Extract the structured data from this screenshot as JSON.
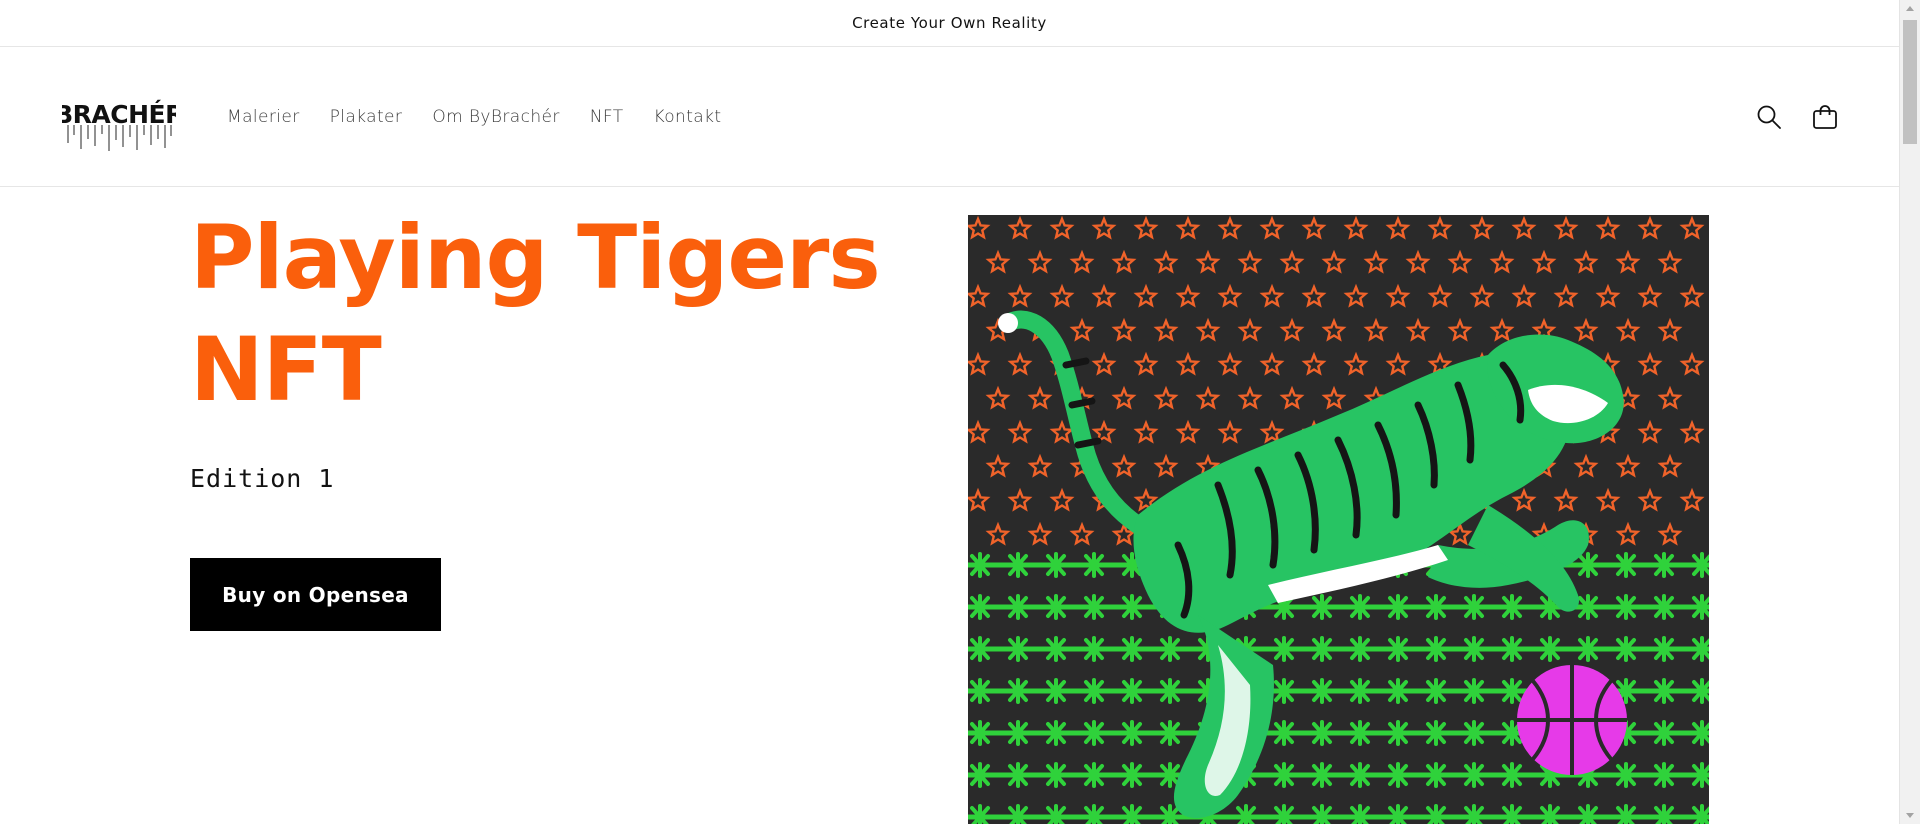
{
  "announcement": {
    "text": "Create Your Own Reality"
  },
  "header": {
    "logo_text": "BRACHÉR",
    "nav": [
      {
        "label": "Malerier"
      },
      {
        "label": "Plakater"
      },
      {
        "label": "Om ByBrachér"
      },
      {
        "label": "NFT"
      },
      {
        "label": "Kontakt"
      }
    ],
    "icons": {
      "search": "search-icon",
      "cart": "cart-icon"
    }
  },
  "hero": {
    "title": "Playing Tigers NFT",
    "subtitle": "Edition 1",
    "button_label": "Buy on Opensea",
    "image_alt": "Green tiger leaping over stars with a pink basketball"
  },
  "colors": {
    "accent": "#fa5f0c",
    "button_bg": "#000000",
    "button_text": "#ffffff",
    "art_background": "#2a2a2a",
    "art_stars": "#f0632a",
    "art_tiger": "#27c463",
    "art_grass": "#2fd23b",
    "art_ball": "#e63ae8"
  }
}
